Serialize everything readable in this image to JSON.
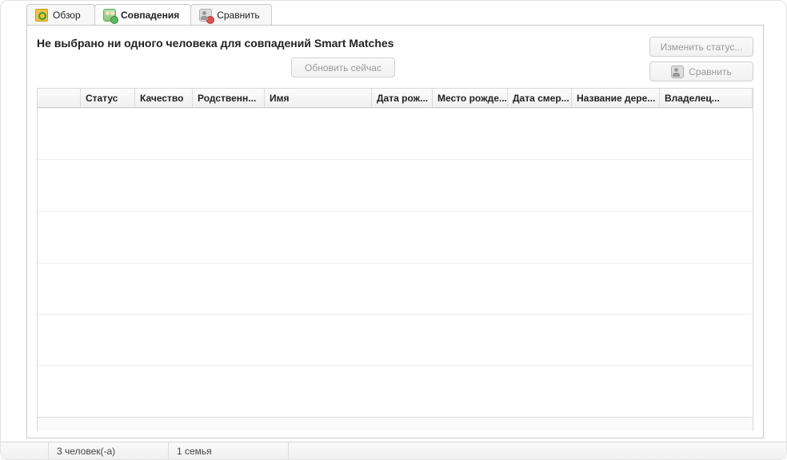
{
  "tabs": {
    "overview": "Обзор",
    "matches": "Совпадения",
    "compare": "Сравнить"
  },
  "main": {
    "title": "Не выбрано ни одного человека для совпадений Smart Matches",
    "refresh_label": "Обновить сейчас",
    "change_status_label": "Изменить статус...",
    "compare_label": "Сравнить"
  },
  "columns": {
    "c0": "",
    "c1": "Статус",
    "c2": "Качество",
    "c3": "Родственн...",
    "c4": "Имя",
    "c5": "Дата рож...",
    "c6": "Место рожде...",
    "c7": "Дата смер...",
    "c8": "Название дере...",
    "c9": "Владелец..."
  },
  "status": {
    "people": "3 человек(-а)",
    "family": "1 семья"
  }
}
